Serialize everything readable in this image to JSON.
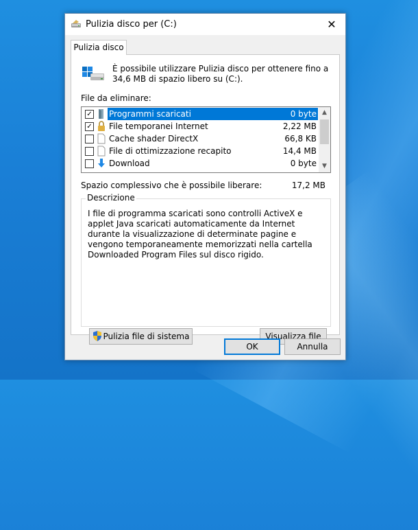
{
  "window": {
    "title": "Pulizia disco per  (C:)",
    "close_label": "✕"
  },
  "tab": {
    "label": "Pulizia disco"
  },
  "intro_text": "È possibile utilizzare Pulizia disco per ottenere fino a 34,6 MB di spazio libero su  (C:).",
  "files_label": "File da eliminare:",
  "files": [
    {
      "name": "Programmi scaricati",
      "size": "0 byte",
      "checked": true,
      "selected": true,
      "icon": "folder-icon"
    },
    {
      "name": "File temporanei Internet",
      "size": "2,22 MB",
      "checked": true,
      "selected": false,
      "icon": "lock-icon"
    },
    {
      "name": "Cache shader DirectX",
      "size": "66,8 KB",
      "checked": false,
      "selected": false,
      "icon": "file-icon"
    },
    {
      "name": "File di ottimizzazione recapito",
      "size": "14,4 MB",
      "checked": false,
      "selected": false,
      "icon": "file-icon"
    },
    {
      "name": "Download",
      "size": "0 byte",
      "checked": false,
      "selected": false,
      "icon": "download-arrow-icon"
    }
  ],
  "checkmark": "✓",
  "total": {
    "label": "Spazio complessivo che è possibile liberare:",
    "value": "17,2 MB"
  },
  "description": {
    "legend": "Descrizione",
    "text": "I file di programma scaricati sono controlli ActiveX e applet Java scaricati automaticamente da Internet durante la visualizzazione di determinate pagine e vengono temporaneamente memorizzati nella cartella Downloaded Program Files sul disco rigido."
  },
  "buttons": {
    "cleanup_system": "Pulizia file di sistema",
    "view_files": "Visualizza file",
    "ok": "OK",
    "cancel": "Annulla"
  },
  "scroll": {
    "up": "▲",
    "down": "▼"
  },
  "colors": {
    "selection": "#0078d7",
    "window_bg": "#f0f0f0",
    "desktop": "#1a7fd6"
  }
}
